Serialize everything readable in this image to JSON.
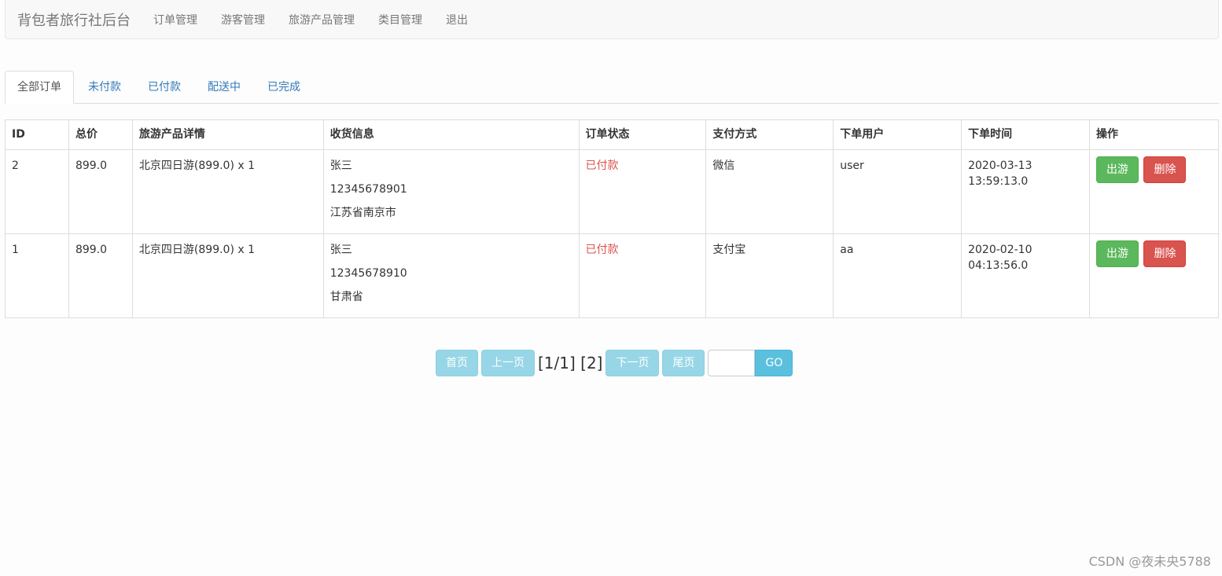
{
  "navbar": {
    "brand": "背包者旅行社后台",
    "links": [
      "订单管理",
      "游客管理",
      "旅游产品管理",
      "类目管理",
      "退出"
    ]
  },
  "tabs": [
    {
      "label": "全部订单",
      "active": true
    },
    {
      "label": "未付款",
      "active": false
    },
    {
      "label": "已付款",
      "active": false
    },
    {
      "label": "配送中",
      "active": false
    },
    {
      "label": "已完成",
      "active": false
    }
  ],
  "table": {
    "headers": [
      "ID",
      "总价",
      "旅游产品详情",
      "收货信息",
      "订单状态",
      "支付方式",
      "下单用户",
      "下单时间",
      "操作"
    ],
    "rows": [
      {
        "id": "2",
        "total": "899.0",
        "product": "北京四日游(899.0) x 1",
        "name": "张三",
        "phone": "12345678901",
        "address": "江苏省南京市",
        "status": "已付款",
        "payment": "微信",
        "user": "user",
        "time": "2020-03-13 13:59:13.0",
        "btn_travel": "出游",
        "btn_delete": "删除"
      },
      {
        "id": "1",
        "total": "899.0",
        "product": "北京四日游(899.0) x 1",
        "name": "张三",
        "phone": "12345678910",
        "address": "甘肃省",
        "status": "已付款",
        "payment": "支付宝",
        "user": "aa",
        "time": "2020-02-10 04:13:56.0",
        "btn_travel": "出游",
        "btn_delete": "删除"
      }
    ]
  },
  "pager": {
    "first": "首页",
    "prev": "上一页",
    "info": "[1/1] [2]",
    "next": "下一页",
    "last": "尾页",
    "input_value": "",
    "go": "GO"
  },
  "watermark": "CSDN @夜未央5788",
  "colors": {
    "status": "#d9534f",
    "travel_btn": "#5cb85c",
    "delete_btn": "#d9534f",
    "pager_btn": "#97d6e6",
    "go_btn": "#5bc0de"
  }
}
